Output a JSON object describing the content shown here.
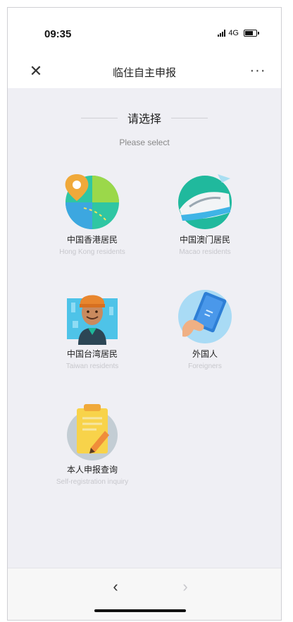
{
  "status": {
    "time": "09:35",
    "network": "4G"
  },
  "nav": {
    "close_icon": "close-icon",
    "title": "临住自主申报",
    "more_label": "···"
  },
  "page": {
    "heading": "请选择",
    "subheading": "Please select"
  },
  "options": [
    {
      "cn": "中国香港居民",
      "en": "Hong Kong residents",
      "icon": "map-pin-icon"
    },
    {
      "cn": "中国澳门居民",
      "en": "Macao residents",
      "icon": "high-speed-train-icon"
    },
    {
      "cn": "中国台湾居民",
      "en": "Taiwan residents",
      "icon": "person-icon"
    },
    {
      "cn": "外国人",
      "en": "Foreigners",
      "icon": "passport-icon"
    },
    {
      "cn": "本人申报查询",
      "en": "Self-registration inquiry",
      "icon": "clipboard-icon"
    }
  ],
  "bottom": {
    "back": "‹",
    "forward": "›"
  },
  "colors": {
    "content_bg": "#efeff4",
    "teal": "#1fb89a",
    "blue": "#3ca7e0",
    "orange": "#f2a63a",
    "yellow": "#f8d34a"
  }
}
